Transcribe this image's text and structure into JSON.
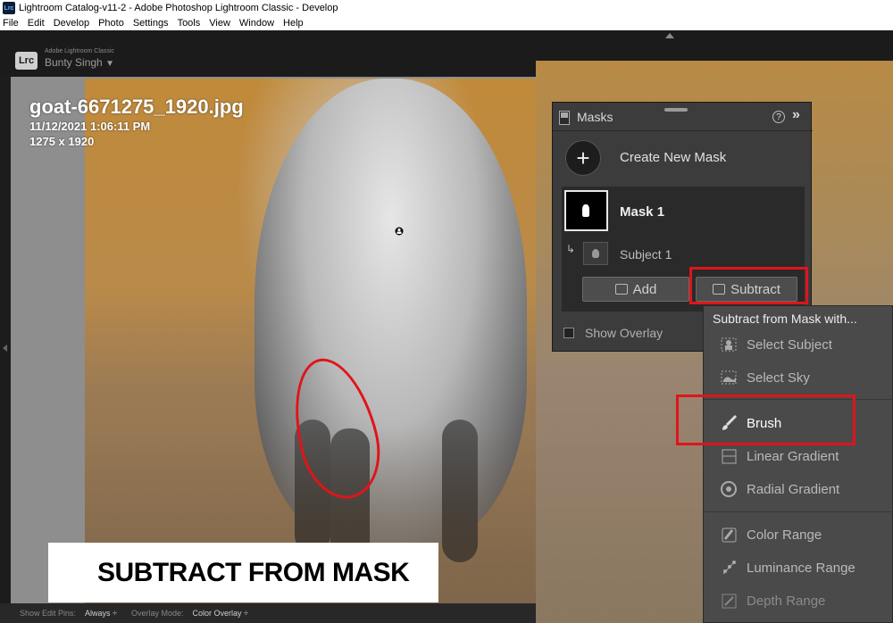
{
  "window": {
    "title": "Lightroom Catalog-v11-2 - Adobe Photoshop Lightroom Classic - Develop",
    "app_icon_label": "Lrc"
  },
  "menubar": {
    "items": [
      "File",
      "Edit",
      "Develop",
      "Photo",
      "Settings",
      "Tools",
      "View",
      "Window",
      "Help"
    ]
  },
  "identity": {
    "logo": "Lrc",
    "product": "Adobe Lightroom Classic",
    "user": "Bunty Singh"
  },
  "photo": {
    "filename": "goat-6671275_1920.jpg",
    "datetime": "11/12/2021 1:06:11 PM",
    "dimensions": "1275 x 1920"
  },
  "caption": "SUBTRACT FROM MASK",
  "bottom_bar": {
    "show_edit_pins_label": "Show Edit Pins:",
    "show_edit_pins_value": "Always ÷",
    "overlay_mode_label": "Overlay Mode:",
    "overlay_mode_value": "Color Overlay ÷"
  },
  "masks_panel": {
    "title": "Masks",
    "help": "?",
    "collapse": "»",
    "create_new_mask": "Create New Mask",
    "mask_name": "Mask 1",
    "subject_name": "Subject 1",
    "add_label": "Add",
    "subtract_label": "Subtract",
    "show_overlay": "Show Overlay"
  },
  "subtract_menu": {
    "title": "Subtract from Mask with...",
    "items": [
      {
        "label": "Select Subject",
        "icon": "select-subject-icon"
      },
      {
        "label": "Select Sky",
        "icon": "select-sky-icon"
      },
      {
        "label": "Brush",
        "icon": "brush-icon"
      },
      {
        "label": "Linear Gradient",
        "icon": "linear-gradient-icon"
      },
      {
        "label": "Radial Gradient",
        "icon": "radial-gradient-icon"
      },
      {
        "label": "Color Range",
        "icon": "color-range-icon"
      },
      {
        "label": "Luminance Range",
        "icon": "luminance-range-icon"
      },
      {
        "label": "Depth Range",
        "icon": "depth-range-icon"
      }
    ]
  },
  "colors": {
    "highlight": "#e0141a",
    "panel_bg": "#3c3c3c",
    "menu_bg": "#4a4a4a"
  }
}
